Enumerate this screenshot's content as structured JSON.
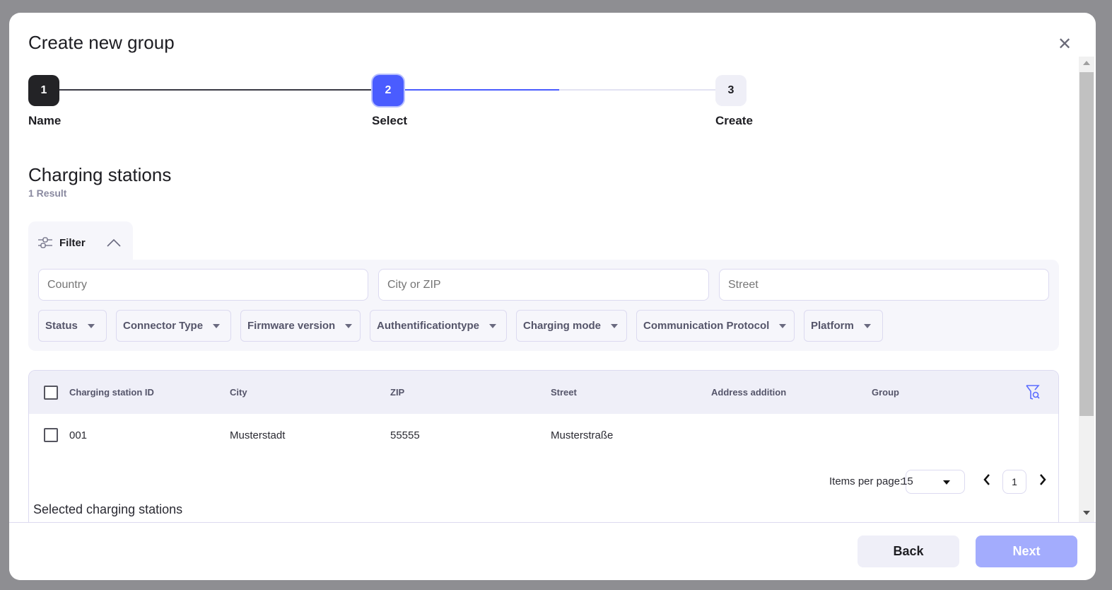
{
  "modal": {
    "title": "Create new group",
    "close_icon": "close-icon"
  },
  "stepper": [
    {
      "num": "1",
      "label": "Name"
    },
    {
      "num": "2",
      "label": "Select"
    },
    {
      "num": "3",
      "label": "Create"
    }
  ],
  "section": {
    "title": "Charging stations",
    "result": "1 Result"
  },
  "filter": {
    "label": "Filter",
    "inputs": [
      {
        "placeholder": "Country"
      },
      {
        "placeholder": "City or ZIP"
      },
      {
        "placeholder": "Street"
      }
    ],
    "dropdowns": [
      "Status",
      "Connector Type",
      "Firmware version",
      "Authentificationtype",
      "Charging mode",
      "Communication Protocol",
      "Platform"
    ]
  },
  "table": {
    "headers": [
      "Charging station ID",
      "City",
      "ZIP",
      "Street",
      "Address addition",
      "Group"
    ],
    "rows": [
      [
        "001",
        "Musterstadt",
        "55555",
        "Musterstraße",
        "",
        ""
      ]
    ]
  },
  "pagination": {
    "items_label": "Items per page:",
    "items_value": "15",
    "page": "1"
  },
  "selected_label": "Selected charging stations",
  "footer": {
    "back": "Back",
    "next": "Next"
  },
  "colors": {
    "accent": "#4a5cff",
    "next_disabled": "#a3acfd"
  }
}
